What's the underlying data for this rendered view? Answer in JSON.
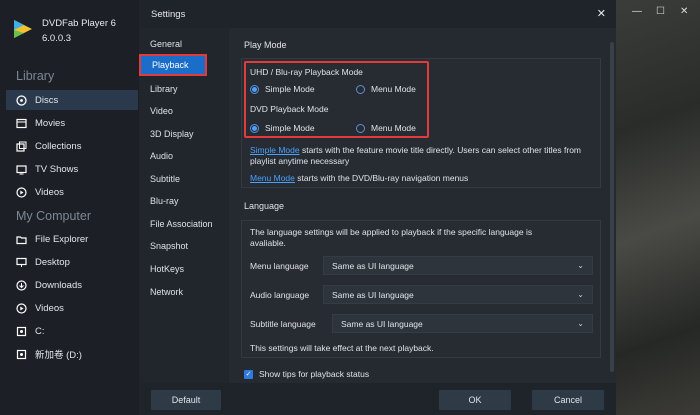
{
  "app": {
    "name": "DVDFab Player 6",
    "version": "6.0.0.3",
    "library_title": "Library",
    "library_items": [
      {
        "label": "Discs",
        "icon": "disc-icon"
      },
      {
        "label": "Movies",
        "icon": "film-icon"
      },
      {
        "label": "Collections",
        "icon": "collections-icon"
      },
      {
        "label": "TV Shows",
        "icon": "tv-icon"
      },
      {
        "label": "Videos",
        "icon": "video-icon"
      }
    ],
    "computer_title": "My Computer",
    "computer_items": [
      {
        "label": "File Explorer",
        "icon": "folder-icon"
      },
      {
        "label": "Desktop",
        "icon": "desktop-icon"
      },
      {
        "label": "Downloads",
        "icon": "download-icon"
      },
      {
        "label": "Videos",
        "icon": "video-icon"
      },
      {
        "label": "C:",
        "icon": "drive-icon"
      },
      {
        "label": "新加卷 (D:)",
        "icon": "drive-icon"
      }
    ]
  },
  "dialog": {
    "title": "Settings",
    "nav": [
      "General",
      "Playback",
      "Library",
      "Video",
      "3D Display",
      "Audio",
      "Subtitle",
      "Blu-ray",
      "File Association",
      "Snapshot",
      "HotKeys",
      "Network"
    ],
    "active_nav": "Playback",
    "play_mode": {
      "title": "Play Mode",
      "uhd_label": "UHD / Blu-ray Playback Mode",
      "dvd_label": "DVD Playback Mode",
      "simple": "Simple Mode",
      "menu": "Menu Mode",
      "simple_link": "Simple Mode",
      "simple_desc": " starts with the feature movie title directly. Users can select other titles from playlist anytime necessary",
      "menu_link": "Menu Mode",
      "menu_desc": " starts with the DVD/Blu-ray navigation menus"
    },
    "language": {
      "title": "Language",
      "desc": "The language settings will be applied to playback if the specific language is avaliable.",
      "menu_label": "Menu language",
      "audio_label": "Audio language",
      "subtitle_label": "Subtitle language",
      "menu_value": "Same as UI language",
      "audio_value": "Same as UI language",
      "subtitle_value": "Same as UI language",
      "note": "This settings will take effect at the next playback."
    },
    "show_tips": "Show tips for playback status",
    "buttons": {
      "default": "Default",
      "ok": "OK",
      "cancel": "Cancel"
    }
  },
  "colors": {
    "accent": "#1a6dc8",
    "highlight": "#e23b3b",
    "link": "#4aa0ff"
  }
}
